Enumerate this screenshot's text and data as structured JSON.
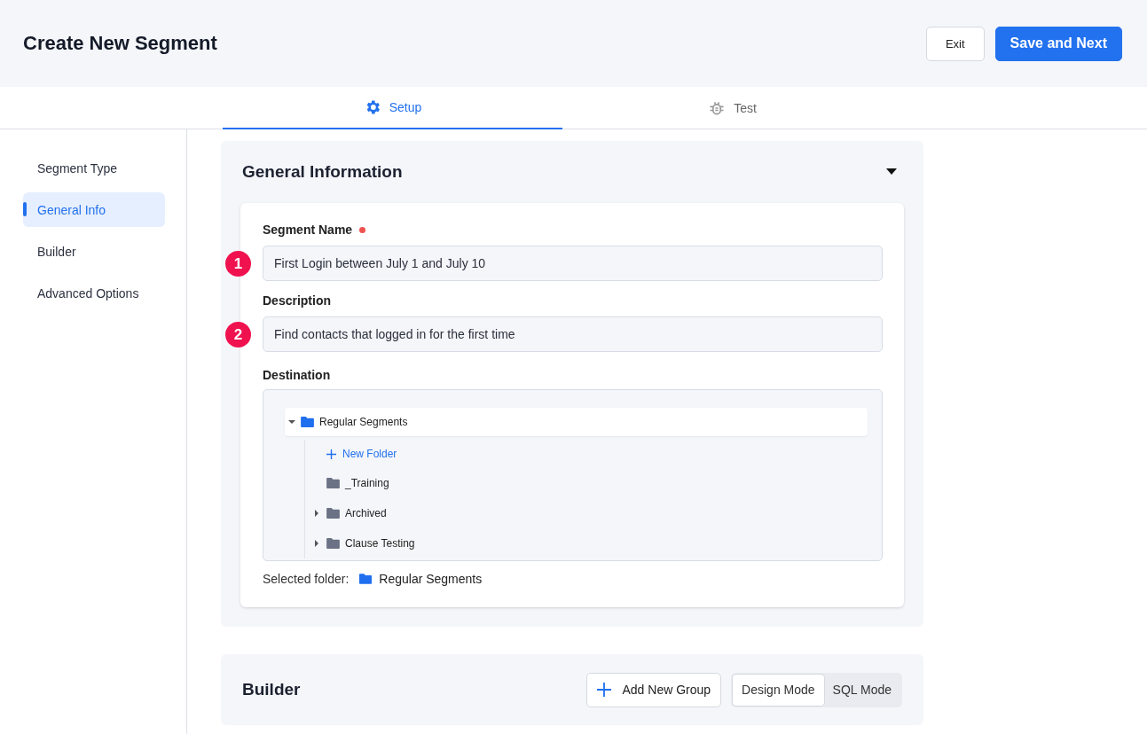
{
  "header": {
    "title": "Create New Segment",
    "buttons": [
      {
        "label": "Exit",
        "kind": "secondary"
      },
      {
        "label": "Save and Next",
        "kind": "primary"
      }
    ]
  },
  "tabs": [
    {
      "label": "Setup",
      "selected": true
    },
    {
      "label": "Test",
      "selected": false
    }
  ],
  "sidebar": {
    "items": [
      {
        "label": "Segment Type",
        "selected": false
      },
      {
        "label": "General Info",
        "selected": true
      },
      {
        "label": "Builder",
        "selected": false
      },
      {
        "label": "Advanced Options",
        "selected": false
      }
    ]
  },
  "general": {
    "title": "General Information",
    "expanded": true,
    "fields": [
      {
        "label": "Segment Name",
        "required": true,
        "value": "First Login between July 1 and July 10",
        "badge": "1"
      },
      {
        "label": "Description",
        "value": "Find contacts that logged in for the first time",
        "badge": "2"
      }
    ],
    "destination": {
      "label": "Destination",
      "new_folder": "New Folder",
      "tree": [
        {
          "label": "Regular Segments",
          "expanded": true,
          "selected": true,
          "children": [
            {
              "label": "_Training",
              "has_children": false
            },
            {
              "label": "Archived",
              "has_children": true
            },
            {
              "label": "Clause Testing",
              "has_children": true
            }
          ]
        }
      ],
      "selected_label": "Selected folder:",
      "selected_value": "Regular Segments"
    }
  },
  "builder": {
    "title": "Builder",
    "add_button": "Add New Group",
    "modes": [
      {
        "label": "Design Mode",
        "selected": true
      },
      {
        "label": "SQL Mode",
        "selected": false
      }
    ]
  }
}
